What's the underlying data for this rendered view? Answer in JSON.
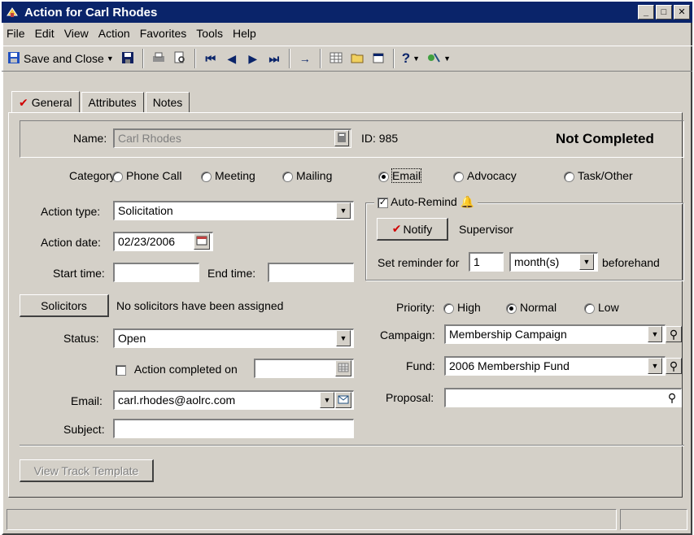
{
  "window": {
    "title": "Action for Carl Rhodes"
  },
  "menu": [
    "File",
    "Edit",
    "View",
    "Action",
    "Favorites",
    "Tools",
    "Help"
  ],
  "toolbar": {
    "save_close_label": "Save and Close"
  },
  "tabs": [
    "General",
    "Attributes",
    "Notes"
  ],
  "name": {
    "label": "Name:",
    "value": "Carl Rhodes",
    "id_text": "ID: 985",
    "completion_status": "Not Completed"
  },
  "category": {
    "label": "Category:",
    "options": [
      "Phone Call",
      "Meeting",
      "Mailing",
      "Email",
      "Advocacy",
      "Task/Other"
    ],
    "selected": "Email"
  },
  "action_type": {
    "label": "Action type:",
    "value": "Solicitation"
  },
  "action_date": {
    "label": "Action date:",
    "value": "02/23/2006"
  },
  "start_time": {
    "label": "Start time:",
    "value": ""
  },
  "end_time": {
    "label": "End time:",
    "value": ""
  },
  "reminder": {
    "auto_remind_label": "Auto-Remind",
    "auto_remind_checked": true,
    "notify_label": "Notify",
    "notify_target": "Supervisor",
    "set_label": "Set reminder for",
    "amount": "1",
    "unit": "month(s)",
    "suffix": "beforehand"
  },
  "solicitors": {
    "button_label": "Solicitors",
    "text": "No solicitors have been assigned"
  },
  "priority": {
    "label": "Priority:",
    "options": [
      "High",
      "Normal",
      "Low"
    ],
    "selected": "Normal"
  },
  "status": {
    "label": "Status:",
    "value": "Open"
  },
  "campaign": {
    "label": "Campaign:",
    "value": "Membership Campaign"
  },
  "action_completed": {
    "label": "Action completed on",
    "checked": false,
    "value": ""
  },
  "fund": {
    "label": "Fund:",
    "value": "2006 Membership Fund"
  },
  "email": {
    "label": "Email:",
    "value": "carl.rhodes@aolrc.com"
  },
  "proposal": {
    "label": "Proposal:",
    "value": ""
  },
  "subject": {
    "label": "Subject:",
    "value": ""
  },
  "view_track_template_label": "View Track Template",
  "colors": {
    "titlebar": "#0a246a",
    "face": "#d4d0c8",
    "check_red": "#d00000"
  }
}
